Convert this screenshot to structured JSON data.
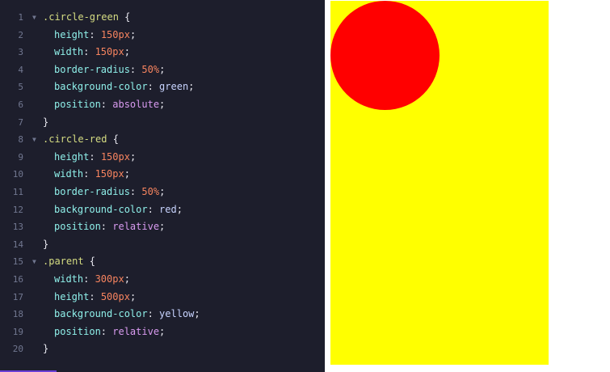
{
  "colors": {
    "editor_bg": "#1d1e2c",
    "preview_parent": "#ffff00",
    "preview_circle": "#ff0000"
  },
  "editor": {
    "lines": [
      {
        "num": "1",
        "fold": true,
        "indent": 0,
        "tokens": [
          {
            "t": ".circle-green",
            "c": "sel"
          },
          {
            "t": " {",
            "c": "punc"
          }
        ]
      },
      {
        "num": "2",
        "fold": false,
        "indent": 1,
        "tokens": [
          {
            "t": "height",
            "c": "prop"
          },
          {
            "t": ": ",
            "c": "punc"
          },
          {
            "t": "150px",
            "c": "num"
          },
          {
            "t": ";",
            "c": "punc"
          }
        ]
      },
      {
        "num": "3",
        "fold": false,
        "indent": 1,
        "tokens": [
          {
            "t": "width",
            "c": "prop"
          },
          {
            "t": ": ",
            "c": "punc"
          },
          {
            "t": "150px",
            "c": "num"
          },
          {
            "t": ";",
            "c": "punc"
          }
        ]
      },
      {
        "num": "4",
        "fold": false,
        "indent": 1,
        "tokens": [
          {
            "t": "border-radius",
            "c": "prop"
          },
          {
            "t": ": ",
            "c": "punc"
          },
          {
            "t": "50%",
            "c": "num"
          },
          {
            "t": ";",
            "c": "punc"
          }
        ]
      },
      {
        "num": "5",
        "fold": false,
        "indent": 1,
        "tokens": [
          {
            "t": "background-color",
            "c": "prop"
          },
          {
            "t": ": ",
            "c": "punc"
          },
          {
            "t": "green",
            "c": "val"
          },
          {
            "t": ";",
            "c": "punc"
          }
        ]
      },
      {
        "num": "6",
        "fold": false,
        "indent": 1,
        "tokens": [
          {
            "t": "position",
            "c": "prop"
          },
          {
            "t": ": ",
            "c": "punc"
          },
          {
            "t": "absolute",
            "c": "kw"
          },
          {
            "t": ";",
            "c": "punc"
          }
        ]
      },
      {
        "num": "7",
        "fold": false,
        "indent": 0,
        "tokens": [
          {
            "t": "}",
            "c": "punc"
          }
        ]
      },
      {
        "num": "8",
        "fold": true,
        "indent": 0,
        "tokens": [
          {
            "t": ".circle-red",
            "c": "sel"
          },
          {
            "t": " {",
            "c": "punc"
          }
        ]
      },
      {
        "num": "9",
        "fold": false,
        "indent": 1,
        "tokens": [
          {
            "t": "height",
            "c": "prop"
          },
          {
            "t": ": ",
            "c": "punc"
          },
          {
            "t": "150px",
            "c": "num"
          },
          {
            "t": ";",
            "c": "punc"
          }
        ]
      },
      {
        "num": "10",
        "fold": false,
        "indent": 1,
        "tokens": [
          {
            "t": "width",
            "c": "prop"
          },
          {
            "t": ": ",
            "c": "punc"
          },
          {
            "t": "150px",
            "c": "num"
          },
          {
            "t": ";",
            "c": "punc"
          }
        ]
      },
      {
        "num": "11",
        "fold": false,
        "indent": 1,
        "tokens": [
          {
            "t": "border-radius",
            "c": "prop"
          },
          {
            "t": ": ",
            "c": "punc"
          },
          {
            "t": "50%",
            "c": "num"
          },
          {
            "t": ";",
            "c": "punc"
          }
        ]
      },
      {
        "num": "12",
        "fold": false,
        "indent": 1,
        "tokens": [
          {
            "t": "background-color",
            "c": "prop"
          },
          {
            "t": ": ",
            "c": "punc"
          },
          {
            "t": "red",
            "c": "val"
          },
          {
            "t": ";",
            "c": "punc"
          }
        ]
      },
      {
        "num": "13",
        "fold": false,
        "indent": 1,
        "tokens": [
          {
            "t": "position",
            "c": "prop"
          },
          {
            "t": ": ",
            "c": "punc"
          },
          {
            "t": "relative",
            "c": "kw"
          },
          {
            "t": ";",
            "c": "punc"
          }
        ]
      },
      {
        "num": "14",
        "fold": false,
        "indent": 0,
        "tokens": [
          {
            "t": "}",
            "c": "punc"
          }
        ]
      },
      {
        "num": "15",
        "fold": true,
        "indent": 0,
        "tokens": [
          {
            "t": ".parent",
            "c": "sel"
          },
          {
            "t": " {",
            "c": "punc"
          }
        ]
      },
      {
        "num": "16",
        "fold": false,
        "indent": 1,
        "tokens": [
          {
            "t": "width",
            "c": "prop"
          },
          {
            "t": ": ",
            "c": "punc"
          },
          {
            "t": "300px",
            "c": "num"
          },
          {
            "t": ";",
            "c": "punc"
          }
        ]
      },
      {
        "num": "17",
        "fold": false,
        "indent": 1,
        "tokens": [
          {
            "t": "height",
            "c": "prop"
          },
          {
            "t": ": ",
            "c": "punc"
          },
          {
            "t": "500px",
            "c": "num"
          },
          {
            "t": ";",
            "c": "punc"
          }
        ]
      },
      {
        "num": "18",
        "fold": false,
        "indent": 1,
        "tokens": [
          {
            "t": "background-color",
            "c": "prop"
          },
          {
            "t": ": ",
            "c": "punc"
          },
          {
            "t": "yellow",
            "c": "val"
          },
          {
            "t": ";",
            "c": "punc"
          }
        ]
      },
      {
        "num": "19",
        "fold": false,
        "indent": 1,
        "tokens": [
          {
            "t": "position",
            "c": "prop"
          },
          {
            "t": ": ",
            "c": "punc"
          },
          {
            "t": "relative",
            "c": "kw"
          },
          {
            "t": ";",
            "c": "punc"
          }
        ]
      },
      {
        "num": "20",
        "fold": false,
        "indent": 0,
        "tokens": [
          {
            "t": "}",
            "c": "punc"
          }
        ]
      }
    ]
  }
}
